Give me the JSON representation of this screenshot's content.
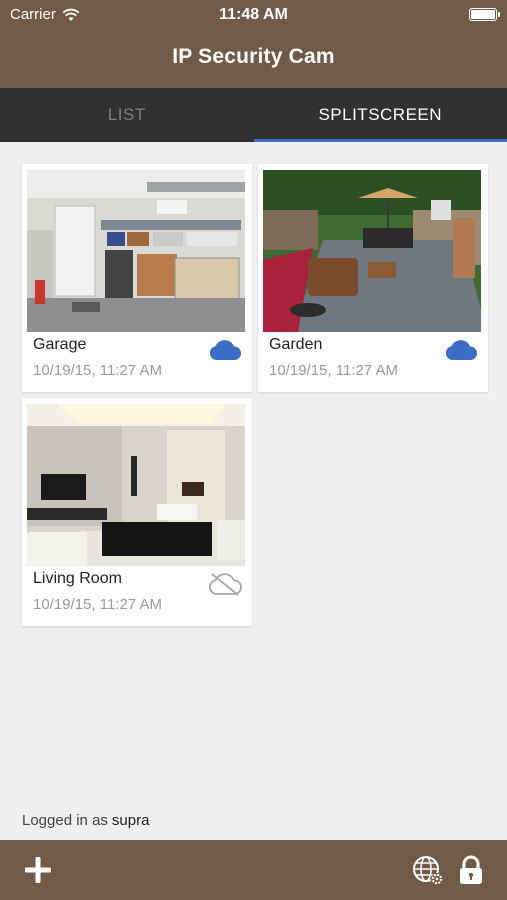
{
  "status_bar": {
    "carrier": "Carrier",
    "time": "11:48 AM"
  },
  "header": {
    "title": "IP Security Cam"
  },
  "tabs": [
    {
      "label": "LIST",
      "active": false
    },
    {
      "label": "SPLITSCREEN",
      "active": true
    }
  ],
  "cameras": [
    {
      "name": "Garage",
      "timestamp": "10/19/15, 11:27 AM",
      "cloud_status": "connected",
      "icon": "cloud-icon"
    },
    {
      "name": "Garden",
      "timestamp": "10/19/15, 11:27 AM",
      "cloud_status": "connected",
      "icon": "cloud-icon"
    },
    {
      "name": "Living Room",
      "timestamp": "10/19/15, 11:27 AM",
      "cloud_status": "offline",
      "icon": "cloud-off-icon"
    }
  ],
  "footer": {
    "logged_in_prefix": "Logged in as",
    "username": "supra",
    "icons": [
      "plus-icon",
      "globe-settings-icon",
      "lock-icon"
    ]
  },
  "colors": {
    "brand_brown": "#715a47",
    "tab_bar": "#2f3133",
    "accent_blue": "#3e6fc6",
    "background": "#efefef"
  }
}
